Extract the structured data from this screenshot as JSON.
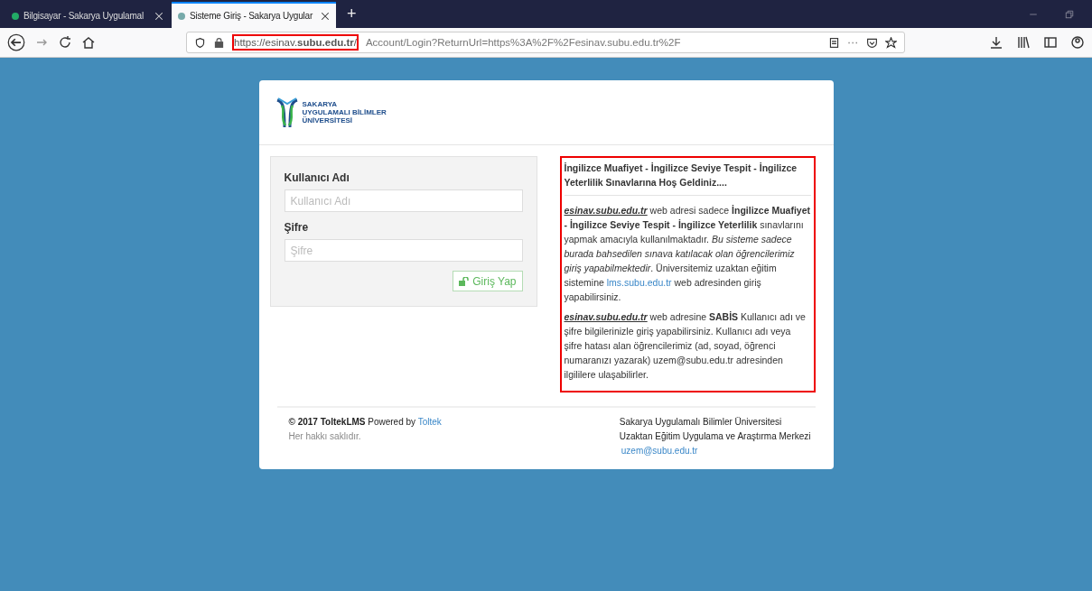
{
  "browser": {
    "tabs": [
      {
        "title": "Bilgisayar - Sakarya Uygulamal",
        "selected": false
      },
      {
        "title": "Sisteme Giriş - Sakarya Uygular",
        "selected": true
      }
    ],
    "new_tab": "+",
    "address": {
      "highlighted_part": "https://esinav.**subu.edu.tr**/",
      "highlighted": true,
      "rest": "Account/Login?ReturnUrl=https%3A%2F%2Fesinav.subu.edu.tr%2F"
    }
  },
  "logo": {
    "lines": [
      "SAKARYA",
      "UYGULAMALI BİLİMLER",
      "ÜNİVERSİTESİ"
    ]
  },
  "login_form": {
    "fields": [
      {
        "label": "Kullanıcı Adı",
        "placeholder": "Kullanıcı Adı"
      },
      {
        "label": "Şifre",
        "placeholder": "Şifre"
      }
    ],
    "submit": "Giriş Yap"
  },
  "info": {
    "highlighted": true,
    "title": "İngilizce Muafiyet - İngilizce Seviye Tespit - İngilizce Yeterlilik Sınavlarına Hoş Geldiniz....",
    "paragraphs": [
      [
        {
          "kind": "site",
          "text": "esinav.subu.edu.tr"
        },
        {
          "kind": "text",
          "text": " web adresi sadece **İngilizce Muafiyet - İngilizce Seviye Tespit - İngilizce Yeterlilik** sınavlarını yapmak amacıyla kullanılmaktadır. *Bu sisteme sadece burada bahsedilen sınava katılacak olan öğrencilerimiz giriş yapabilmektedir*. Üniversitemiz uzaktan eğitim sistemine "
        },
        {
          "kind": "link",
          "text": "lms.subu.edu.tr"
        },
        {
          "kind": "text",
          "text": " web adresinden giriş yapabilirsiniz."
        }
      ],
      [
        {
          "kind": "site",
          "text": "esinav.subu.edu.tr"
        },
        {
          "kind": "text",
          "text": " web adresine **SABİS** Kullanıcı adı ve şifre bilgilerinizle giriş yapabilirsiniz.  Kullanıcı adı veya şifre hatası alan öğrencilerimiz (ad, soyad, öğrenci numaranızı yazarak) uzem@subu.edu.tr adresinden ilgililere ulaşabilirler."
        }
      ]
    ]
  },
  "footer": {
    "left": [
      {
        "kind": "text",
        "text": "**© 2017 ToltekLMS** Powered by "
      },
      {
        "kind": "link",
        "text": "Toltek"
      }
    ],
    "rights": "Her hakkı saklıdır.",
    "right_lines": [
      "Sakarya Uygulamalı Bilimler Üniversitesi",
      "Uzaktan Eğitim Uygulama ve Araştırma Merkezi"
    ],
    "email": "uzem@subu.edu.tr"
  }
}
